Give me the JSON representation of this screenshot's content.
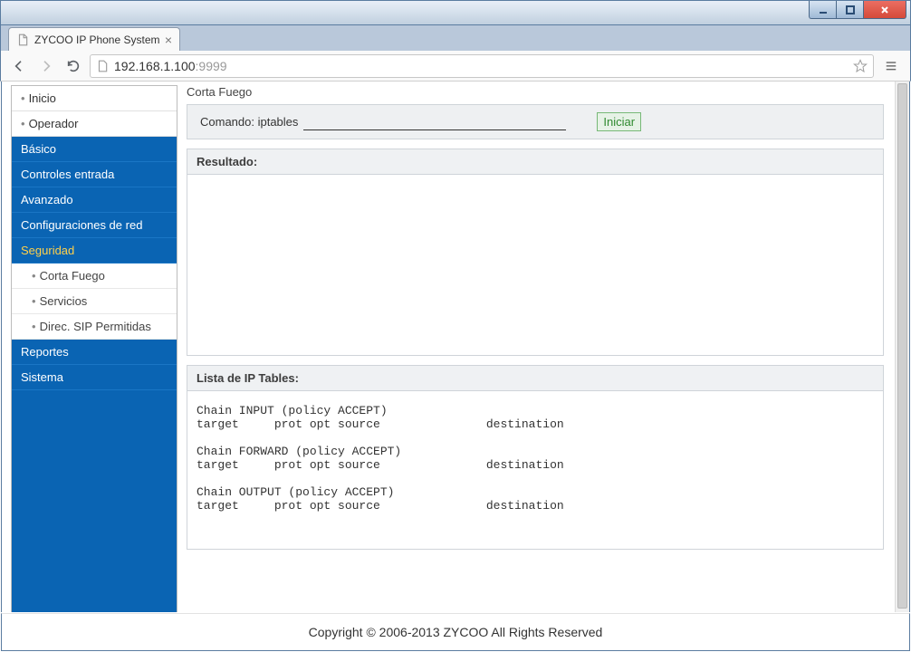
{
  "browser": {
    "tab_title": "ZYCOO IP Phone System",
    "url_host": "192.168.1.100",
    "url_port": ":9999"
  },
  "sidebar": {
    "inicio": "Inicio",
    "operador": "Operador",
    "basico": "Básico",
    "controles": "Controles entrada",
    "avanzado": "Avanzado",
    "config_red": "Configuraciones de red",
    "seguridad": "Seguridad",
    "sub": {
      "corta_fuego": "Corta Fuego",
      "servicios": "Servicios",
      "direc_sip": "Direc. SIP Permitidas"
    },
    "reportes": "Reportes",
    "sistema": "Sistema"
  },
  "main": {
    "title": "Corta Fuego",
    "cmd_label": "Comando: iptables",
    "cmd_value": "",
    "iniciar": "Iniciar",
    "resultado": "Resultado:",
    "lista_header": "Lista de IP Tables:",
    "tables_output": "Chain INPUT (policy ACCEPT)\ntarget     prot opt source               destination\n\nChain FORWARD (policy ACCEPT)\ntarget     prot opt source               destination\n\nChain OUTPUT (policy ACCEPT)\ntarget     prot opt source               destination"
  },
  "footer": "Copyright © 2006-2013 ZYCOO All Rights Reserved"
}
